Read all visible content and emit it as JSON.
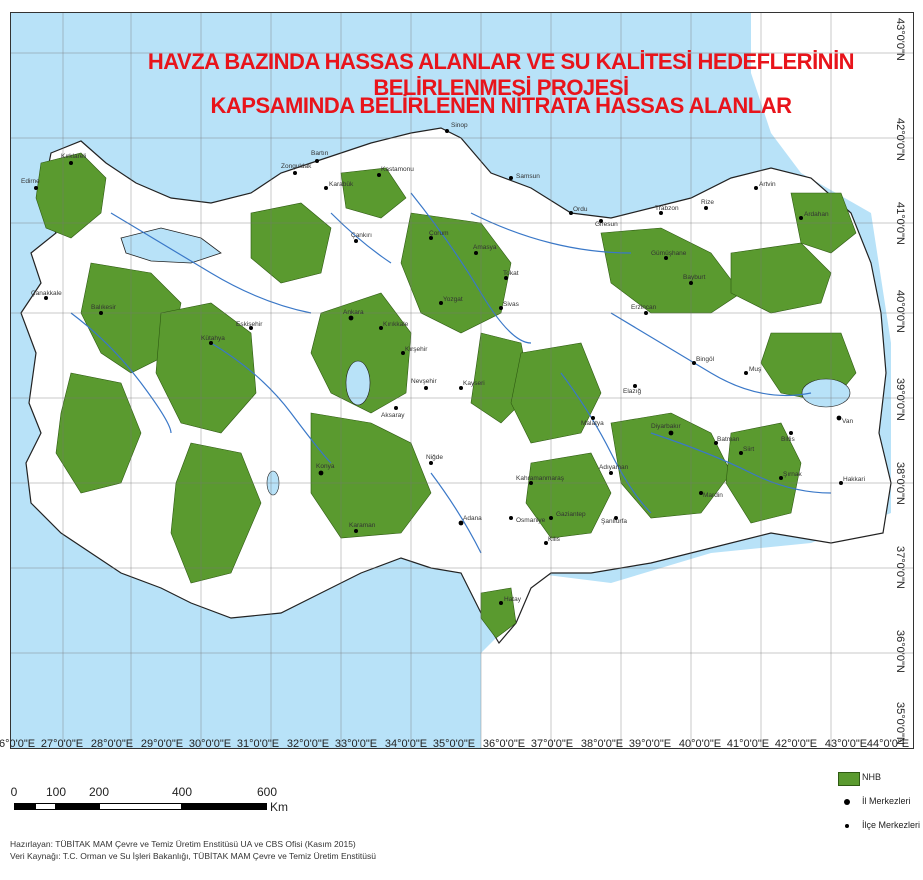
{
  "title": {
    "line1": "HAVZA BAZINDA HASSAS ALANLAR VE SU KALİTESİ HEDEFLERİNİN BELİRLENMESİ PROJESİ",
    "line2": "KAPSAMINDA BELİRLENEN NİTRATA HASSAS ALANLAR"
  },
  "colors": {
    "sea": "#b8e2f8",
    "land": "#ffffff",
    "nhb_area": "#5a9a2f",
    "river": "#3a78c8",
    "border": "#222222"
  },
  "longitude_labels": [
    "26°0'0\"E",
    "27°0'0\"E",
    "28°0'0\"E",
    "29°0'0\"E",
    "30°0'0\"E",
    "31°0'0\"E",
    "32°0'0\"E",
    "33°0'0\"E",
    "34°0'0\"E",
    "35°0'0\"E",
    "36°0'0\"E",
    "37°0'0\"E",
    "38°0'0\"E",
    "39°0'0\"E",
    "40°0'0\"E",
    "41°0'0\"E",
    "42°0'0\"E",
    "43°0'0\"E",
    "44°0'0\"E"
  ],
  "latitude_labels": [
    "43°0'0\"N",
    "42°0'0\"N",
    "41°0'0\"N",
    "40°0'0\"N",
    "39°0'0\"N",
    "38°0'0\"N",
    "37°0'0\"N",
    "36°0'0\"N",
    "35°0'0\"N"
  ],
  "cities": {
    "sinop": "Sinop",
    "bartin": "Bartın",
    "zonguldak": "Zonguldak",
    "karabuk": "Karabük",
    "kastamonu": "Kastamonu",
    "samsun": "Samsun",
    "ordu": "Ordu",
    "giresun": "Giresun",
    "trabzon": "Trabzon",
    "rize": "Rize",
    "artvin": "Artvin",
    "ardahan": "Ardahan",
    "gumushane": "Gümüşhane",
    "bayburt": "Bayburt",
    "erzincan": "Erzincan",
    "cankiri": "Çankırı",
    "corum": "Çorum",
    "amasya": "Amasya",
    "tokat": "Tokat",
    "ankara": "Ankara",
    "eskisehir": "Eskişehir",
    "kutahya": "Kütahya",
    "kirikkale": "Kırıkkale",
    "kirsehir": "Kırşehir",
    "yozgat": "Yozgat",
    "sivas": "Sivas",
    "nevsehir": "Nevşehir",
    "kayseri": "Kayseri",
    "aksaray": "Aksaray",
    "konya": "Konya",
    "karaman": "Karaman",
    "nigde": "Niğde",
    "adana": "Adana",
    "osmaniye": "Osmaniye",
    "hatay": "Hatay",
    "kilis": "Kilis",
    "gaziantep": "Gaziantep",
    "sanliurfa": "Şanlıurfa",
    "adiyaman": "Adıyaman",
    "malatya": "Malatya",
    "elazig": "Elazığ",
    "bingol": "Bingöl",
    "mus": "Muş",
    "bitlis": "Bitlis",
    "van": "Van",
    "hakkari": "Hakkari",
    "sirnak": "Şırnak",
    "mardin": "Mardin",
    "siirt": "Siirt",
    "batman": "Batman",
    "diyarbakir": "Diyarbakır",
    "kirklareli": "Kırklareli",
    "edirne": "Edirne",
    "canakkale": "Çanakkale",
    "balikesir": "Balıkesir",
    "kahramanmaras": "Kahramanmaraş"
  },
  "scale_bar": {
    "labels": [
      "0",
      "100",
      "200",
      "400",
      "600"
    ],
    "unit": "Km"
  },
  "legend": {
    "items": [
      {
        "label": "NHB",
        "symbol": "swatch"
      },
      {
        "label": "İl Merkezleri",
        "symbol": "big-dot"
      },
      {
        "label": "İlçe Merkezleri",
        "symbol": "small-dot"
      }
    ]
  },
  "credits": {
    "line1": "Hazırlayan: TÜBİTAK MAM Çevre ve Temiz Üretim Enstitüsü UA ve CBS Ofisi (Kasım 2015)",
    "line2": "Veri Kaynağı: T.C. Orman ve Su İşleri Bakanlığı, TÜBİTAK MAM Çevre ve Temiz Üretim Enstitüsü"
  }
}
